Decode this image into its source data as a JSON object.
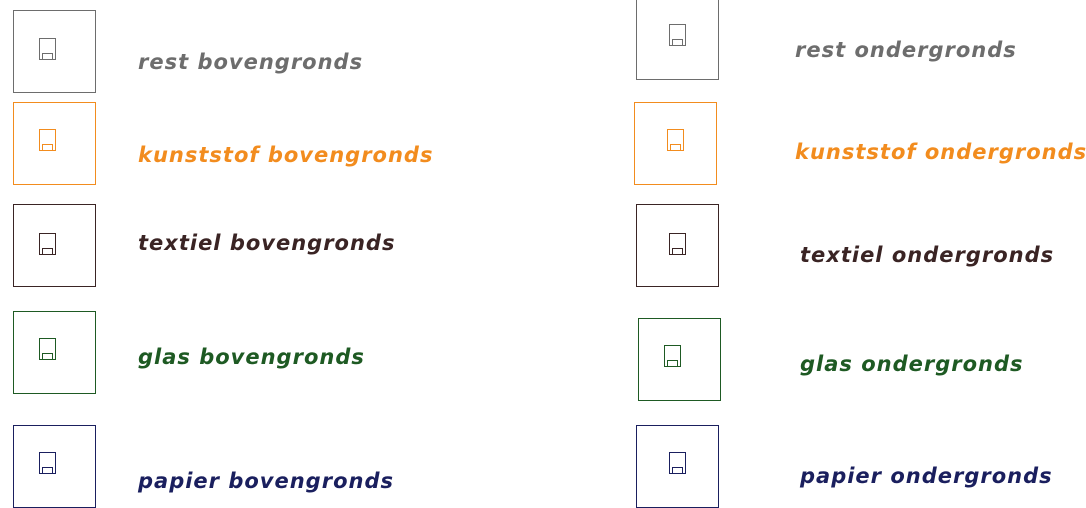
{
  "colors": {
    "rest": "#6d6d6d",
    "kunststof": "#f28c1e",
    "textiel": "#3a2424",
    "glas": "#1e5a23",
    "papier": "#1a1f5e"
  },
  "legend": {
    "left": [
      {
        "label": "rest bovengronds",
        "color_key": "rest",
        "icon": "container-icon"
      },
      {
        "label": "kunststof bovengronds",
        "color_key": "kunststof",
        "icon": "container-icon"
      },
      {
        "label": "textiel bovengronds",
        "color_key": "textiel",
        "icon": "container-icon"
      },
      {
        "label": "glas bovengronds",
        "color_key": "glas",
        "icon": "container-icon"
      },
      {
        "label": "papier bovengronds",
        "color_key": "papier",
        "icon": "container-icon"
      }
    ],
    "right": [
      {
        "label": "rest ondergronds",
        "color_key": "rest",
        "icon": "container-icon"
      },
      {
        "label": "kunststof ondergronds",
        "color_key": "kunststof",
        "icon": "container-icon"
      },
      {
        "label": "textiel ondergronds",
        "color_key": "textiel",
        "icon": "container-icon"
      },
      {
        "label": "glas ondergronds",
        "color_key": "glas",
        "icon": "container-icon"
      },
      {
        "label": "papier ondergronds",
        "color_key": "papier",
        "icon": "container-icon"
      }
    ]
  }
}
